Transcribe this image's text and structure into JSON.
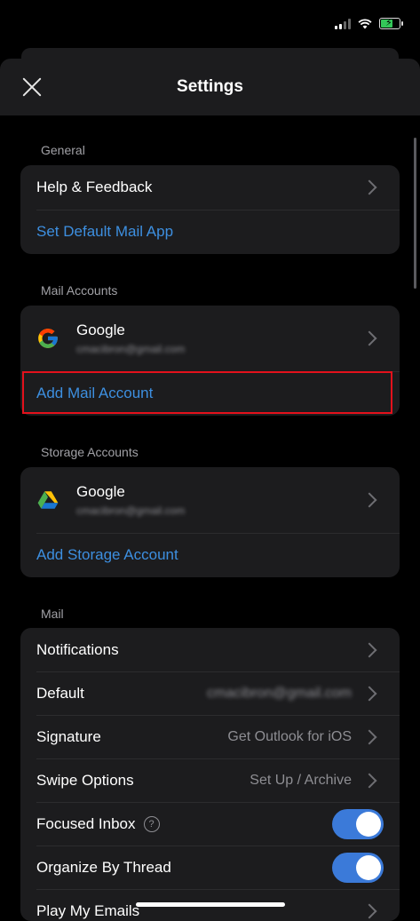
{
  "header": {
    "title": "Settings"
  },
  "sections": {
    "general": {
      "label": "General",
      "help": "Help & Feedback",
      "default_app": "Set Default Mail App"
    },
    "mail_accounts": {
      "label": "Mail Accounts",
      "account_name": "Google",
      "account_email": "cmacibron@gmail.com",
      "add": "Add Mail Account"
    },
    "storage_accounts": {
      "label": "Storage Accounts",
      "account_name": "Google",
      "account_email": "cmacibron@gmail.com",
      "add": "Add Storage Account"
    },
    "mail": {
      "label": "Mail",
      "rows": {
        "notifications": {
          "label": "Notifications"
        },
        "default": {
          "label": "Default",
          "value": "cmacibron@gmail.com"
        },
        "signature": {
          "label": "Signature",
          "value": "Get Outlook for iOS"
        },
        "swipe": {
          "label": "Swipe Options",
          "value": "Set Up / Archive"
        },
        "focused": {
          "label": "Focused Inbox",
          "help": "?",
          "on": true
        },
        "thread": {
          "label": "Organize By Thread",
          "on": true
        },
        "play": {
          "label": "Play My Emails"
        }
      }
    }
  },
  "colors": {
    "link": "#3d8fe0",
    "toggle_on": "#3b7ad9",
    "highlight": "#e3111c",
    "battery": "#34c759"
  }
}
